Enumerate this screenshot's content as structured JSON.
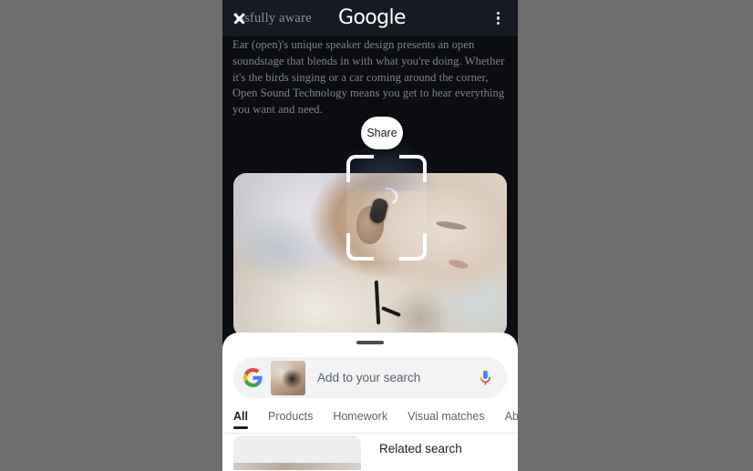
{
  "app_bar": {
    "site_title": "issfully aware",
    "brand": "Google",
    "close_icon": "close-icon",
    "overflow_icon": "more-vert-icon"
  },
  "article": {
    "body": "Ear (open)'s unique speaker design presents an open soundstage that blends in with what you're doing. Whether it's the birds singing or a car coming around the corner, Open Sound Technology means you get to hear everything you want and need."
  },
  "share": {
    "label": "Share"
  },
  "lens": {
    "reticle_name": "lens-selection-reticle"
  },
  "sheet": {
    "search": {
      "placeholder": "Add to your search",
      "google_icon": "google-g-icon",
      "thumbnail": "search-thumbnail-image",
      "mic_icon": "microphone-icon"
    },
    "tabs": [
      {
        "label": "All",
        "active": true
      },
      {
        "label": "Products",
        "active": false
      },
      {
        "label": "Homework",
        "active": false
      },
      {
        "label": "Visual matches",
        "active": false
      },
      {
        "label": "About th",
        "active": false
      }
    ],
    "results": {
      "related_search_label": "Related search"
    }
  },
  "colors": {
    "backdrop": "#6e6e6e",
    "phone_bg": "#0a0a0c",
    "app_bar_bg": "#161a22",
    "article_text": "#7f838c",
    "sheet_bg": "#ffffff",
    "tab_active": "#202124",
    "tab_inactive": "#5f6368",
    "search_bg": "#f1f3f4",
    "google_blue": "#4285F4",
    "google_red": "#EA4335",
    "google_yellow": "#FBBC05",
    "google_green": "#34A853"
  }
}
